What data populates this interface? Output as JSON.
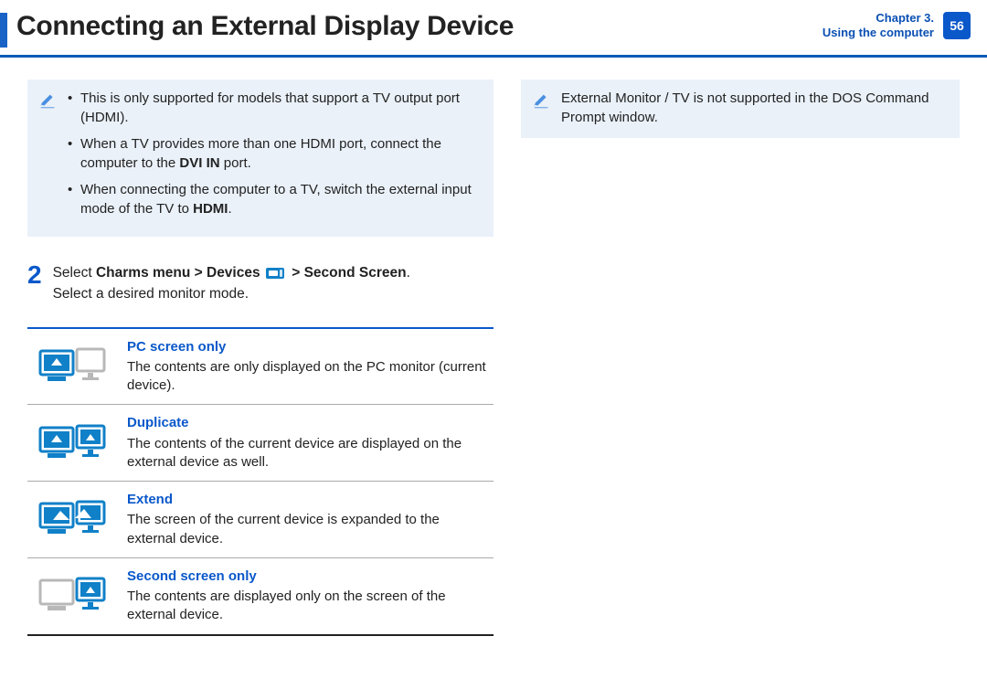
{
  "header": {
    "title": "Connecting an External Display Device",
    "chapter_line1": "Chapter 3.",
    "chapter_line2": "Using the computer",
    "page_number": "56"
  },
  "left_note": {
    "bullets": [
      {
        "pre": "This is only supported for models that support a TV output port (HDMI)."
      },
      {
        "pre": "When a TV provides more than one HDMI port, connect the computer to the ",
        "bold": "DVI IN",
        "post": " port."
      },
      {
        "pre": "When connecting the computer to a TV, switch the external input mode of the TV to ",
        "bold": "HDMI",
        "post": "."
      }
    ]
  },
  "step2": {
    "number": "2",
    "line1_pre": "Select ",
    "line1_b1": "Charms menu > Devices",
    "line1_mid": " ",
    "line1_b2": " > Second Screen",
    "line1_post": ".",
    "line2": "Select a desired monitor mode."
  },
  "modes": [
    {
      "title": "PC screen only",
      "desc": "The contents are only displayed on the PC monitor (current device)."
    },
    {
      "title": "Duplicate",
      "desc": "The contents of the current device are displayed on the external device as well."
    },
    {
      "title": "Extend",
      "desc": "The screen of the current device is expanded to the external device."
    },
    {
      "title": "Second screen only",
      "desc": "The contents are displayed only on the screen of the external device."
    }
  ],
  "right_note": {
    "text": "External Monitor / TV is not supported in the DOS Command Prompt window."
  }
}
